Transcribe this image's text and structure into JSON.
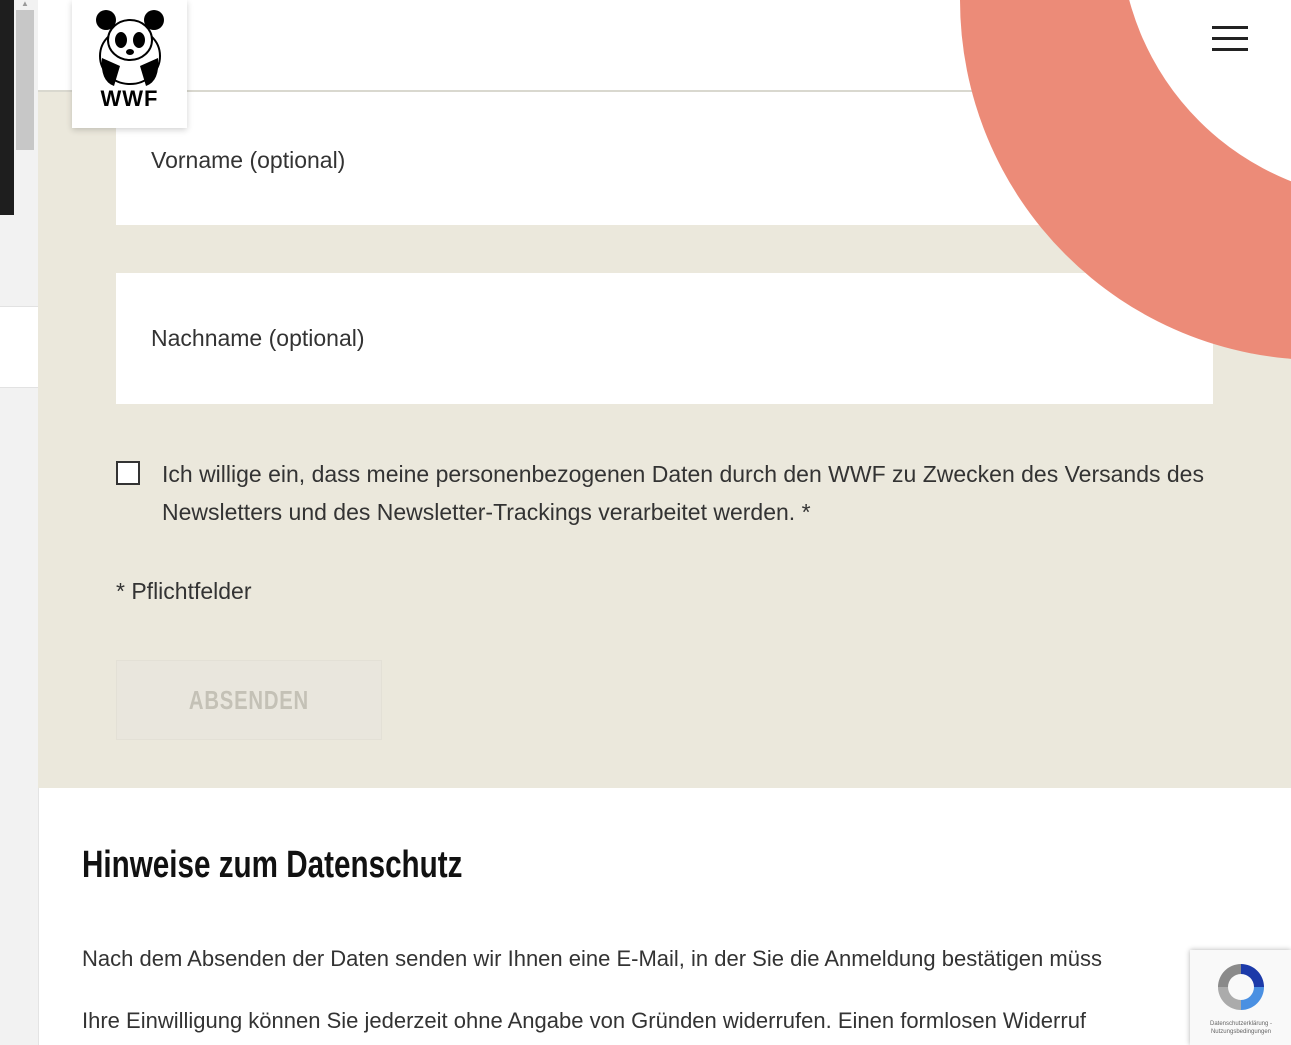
{
  "header": {
    "logo_text": "WWF",
    "menu_icon": "hamburger-icon"
  },
  "form": {
    "first_name_placeholder": "Vorname (optional)",
    "last_name_placeholder": "Nachname (optional)",
    "first_name_value": "",
    "last_name_value": "",
    "consent_checked": false,
    "consent_text": "Ich willige ein, dass meine personenbezogenen Daten durch den WWF zu Zwecken des Versands des Newsletters und des Newsletter-Trackings verarbeitet werden. *",
    "required_note": "* Pflichtfelder",
    "submit_label": "ABSENDEN"
  },
  "privacy": {
    "title": "Hinweise zum Datenschutz",
    "paragraph1": "Nach dem Absenden der Daten senden wir Ihnen eine E-Mail, in der Sie die Anmeldung bestätigen müss",
    "paragraph2": "Ihre Einwilligung können Sie jederzeit ohne Angabe von Gründen widerrufen. Einen formlosen Widerruf"
  },
  "recaptcha": {
    "text": "Datenschutzerklärung - Nutzungsbedingungen"
  },
  "colors": {
    "beige": "#ebe8dc",
    "coral": "#ec8b78",
    "text": "#333333"
  }
}
